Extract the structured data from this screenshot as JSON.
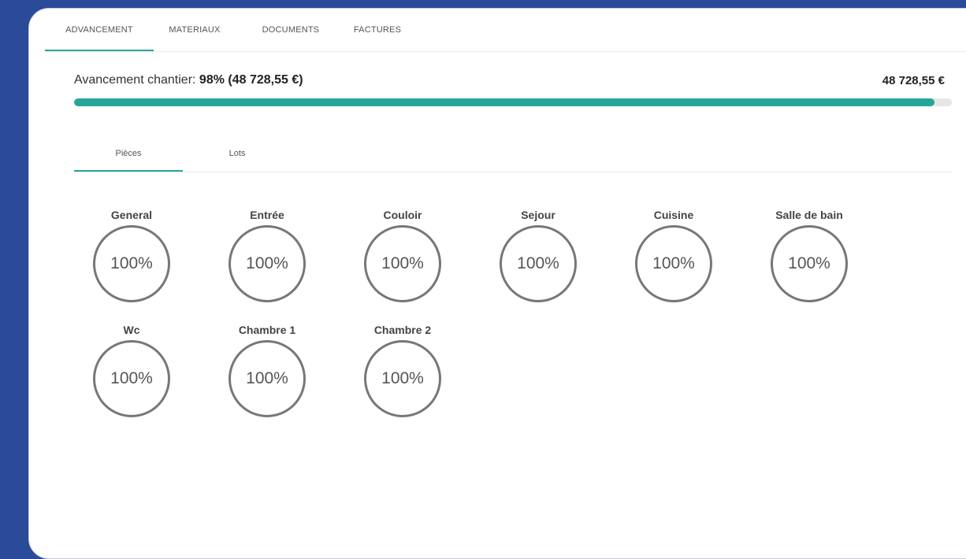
{
  "tabs": [
    {
      "label": "ADVANCEMENT",
      "active": true
    },
    {
      "label": "MATERIAUX",
      "active": false
    },
    {
      "label": "DOCUMENTS",
      "active": false
    },
    {
      "label": "FACTURES",
      "active": false
    }
  ],
  "progress": {
    "label": "Avancement chantier:",
    "percent_text": "98%",
    "amount_text": "(48 728,55 €)",
    "total": "48 728,55 €",
    "fraction": 0.98
  },
  "subtabs": [
    {
      "label": "Pièces",
      "active": true
    },
    {
      "label": "Lots",
      "active": false
    }
  ],
  "rooms": [
    {
      "name": "General",
      "percent": "100%"
    },
    {
      "name": "Entrée",
      "percent": "100%"
    },
    {
      "name": "Couloir",
      "percent": "100%"
    },
    {
      "name": "Sejour",
      "percent": "100%"
    },
    {
      "name": "Cuisine",
      "percent": "100%"
    },
    {
      "name": "Salle de bain",
      "percent": "100%"
    },
    {
      "name": "Wc",
      "percent": "100%"
    },
    {
      "name": "Chambre 1",
      "percent": "100%"
    },
    {
      "name": "Chambre 2",
      "percent": "100%"
    }
  ],
  "colors": {
    "background": "#2a4a9a",
    "accent": "#26a69a",
    "circle_border": "#777777"
  }
}
